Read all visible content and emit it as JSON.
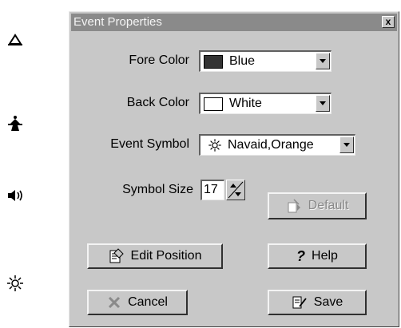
{
  "dialog": {
    "title": "Event Properties",
    "close_label": "x"
  },
  "side_icons": [
    "bell-icon",
    "tower-icon",
    "speaker-icon",
    "sun-icon"
  ],
  "fields": {
    "fore_color": {
      "label": "Fore Color",
      "value": "Blue",
      "swatch": "#333333"
    },
    "back_color": {
      "label": "Back Color",
      "value": "White",
      "swatch": "#ffffff"
    },
    "event_symbol": {
      "label": "Event Symbol",
      "value": "Navaid,Orange",
      "icon": "sun-icon"
    },
    "symbol_size": {
      "label": "Symbol Size",
      "value": "17"
    }
  },
  "buttons": {
    "default": "Default",
    "edit_position": "Edit Position",
    "help": "Help",
    "cancel": "Cancel",
    "save": "Save"
  },
  "colors": {
    "dialog_bg": "#c8c8c8",
    "titlebar_bg": "#8a8a8a"
  }
}
